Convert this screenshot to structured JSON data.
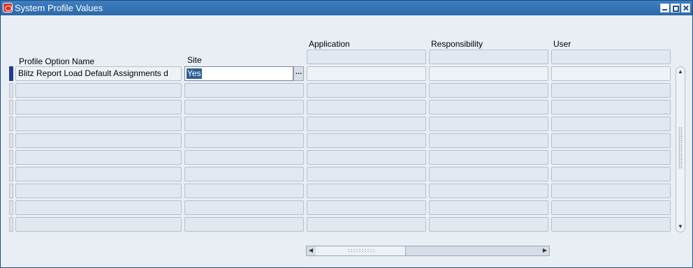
{
  "window": {
    "title": "System Profile Values",
    "title_icon": "oracle-logo-icon",
    "controls": [
      "minimize-icon",
      "maximize-icon",
      "close-icon"
    ]
  },
  "columns": {
    "profile_option_name": "Profile Option Name",
    "site": "Site",
    "application": "Application",
    "responsibility": "Responsibility",
    "user": "User"
  },
  "rows": [
    {
      "profile_option_name": "Blitz Report Load Default Assignments d",
      "site": "Yes",
      "application": "",
      "responsibility": "",
      "user": ""
    }
  ],
  "site_lov_button": "…",
  "colors": {
    "titlebar": "#2b6aaa",
    "background": "#e9eef5",
    "selection": "#2f5f98",
    "active_row_indicator": "#203c8e"
  }
}
